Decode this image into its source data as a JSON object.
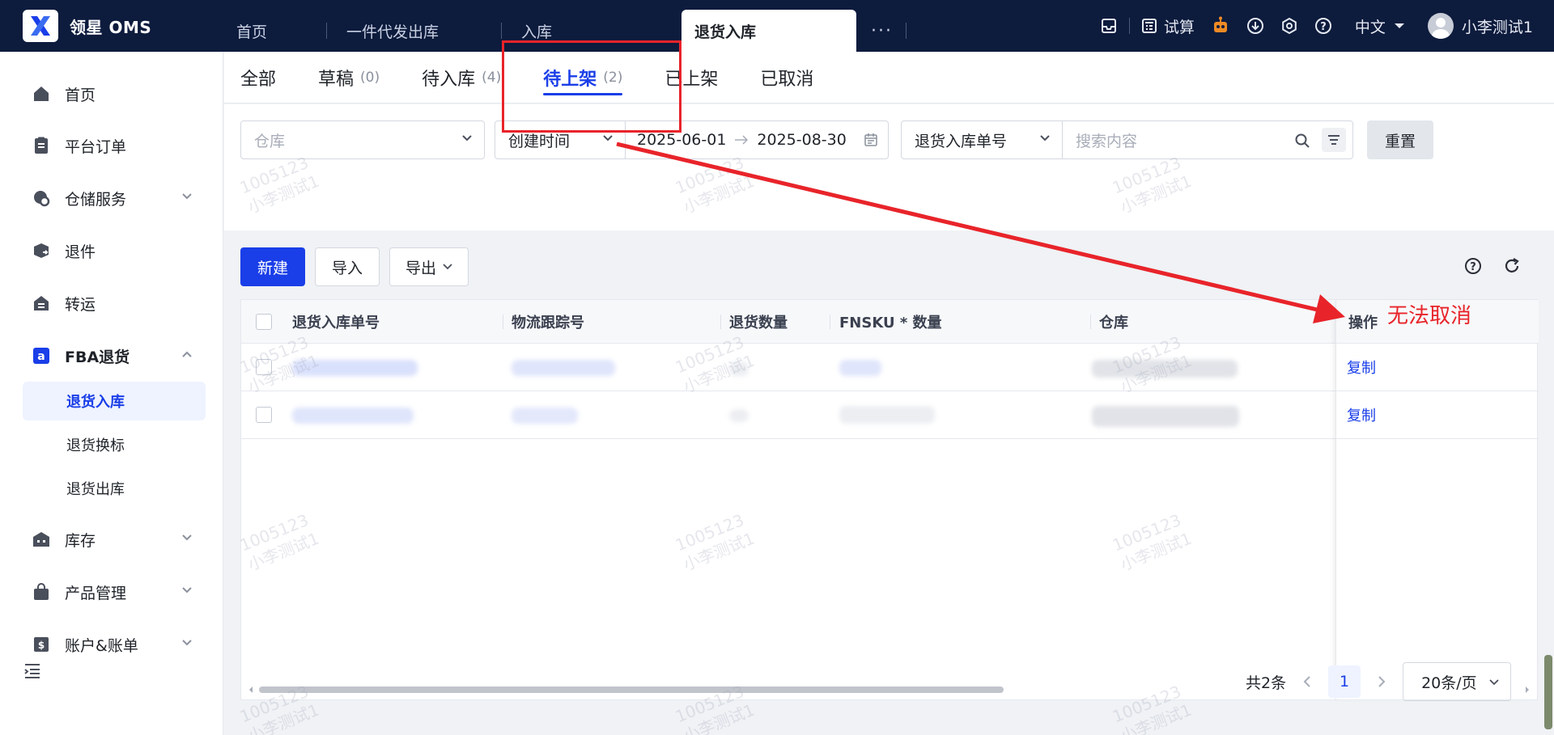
{
  "brand": {
    "name": "领星 OMS"
  },
  "top_tabs": [
    {
      "label": "首页"
    },
    {
      "label": "一件代发出库"
    },
    {
      "label": "入库"
    },
    {
      "label": "退货入库",
      "active": true
    }
  ],
  "top_right": {
    "calc_label": "试算",
    "lang_label": "中文",
    "user_name": "小李测试1"
  },
  "sidebar": {
    "items": [
      {
        "label": "首页",
        "icon": "home-icon"
      },
      {
        "label": "平台订单",
        "icon": "clipboard-icon"
      },
      {
        "label": "仓储服务",
        "icon": "warehouse-service-icon",
        "expandable": true
      },
      {
        "label": "退件",
        "icon": "return-package-icon"
      },
      {
        "label": "转运",
        "icon": "transfer-icon"
      },
      {
        "label": "FBA退货",
        "icon": "amazon-icon",
        "expanded": true
      },
      {
        "label": "库存",
        "icon": "inventory-icon",
        "expandable": true
      },
      {
        "label": "产品管理",
        "icon": "bag-icon",
        "expandable": true
      },
      {
        "label": "账户&账单",
        "icon": "billing-icon",
        "expandable": true
      }
    ],
    "sub_items": [
      {
        "label": "退货入库",
        "active": true
      },
      {
        "label": "退货换标"
      },
      {
        "label": "退货出库"
      }
    ]
  },
  "status_tabs": [
    {
      "label": "全部",
      "count": ""
    },
    {
      "label": "草稿",
      "count": "(0)"
    },
    {
      "label": "待入库",
      "count": "(4)"
    },
    {
      "label": "待上架",
      "count": "(2)",
      "active": true
    },
    {
      "label": "已上架",
      "count": ""
    },
    {
      "label": "已取消",
      "count": ""
    }
  ],
  "filters": {
    "warehouse_placeholder": "仓库",
    "date_type": "创建时间",
    "date_start": "2025-06-01",
    "date_end": "2025-08-30",
    "search_field": "退货入库单号",
    "search_placeholder": "搜索内容",
    "reset_label": "重置"
  },
  "toolbar": {
    "new_label": "新建",
    "import_label": "导入",
    "export_label": "导出"
  },
  "table": {
    "columns": [
      "退货入库单号",
      "物流跟踪号",
      "退货数量",
      "FNSKU * 数量",
      "仓库",
      "操作"
    ],
    "rows": [
      {
        "action_copy": "复制"
      },
      {
        "action_copy": "复制"
      }
    ]
  },
  "pagination": {
    "total_label": "共2条",
    "current_page": "1",
    "page_size_label": "20条/页"
  },
  "watermark": {
    "line1": "1005123",
    "line2": "小李测试1"
  },
  "annotation": {
    "text": "无法取消",
    "color": "#e8242a"
  },
  "colors": {
    "primary": "#1a3ee8",
    "topbar": "#0d1b3d",
    "annotation_red": "#e8242a"
  }
}
